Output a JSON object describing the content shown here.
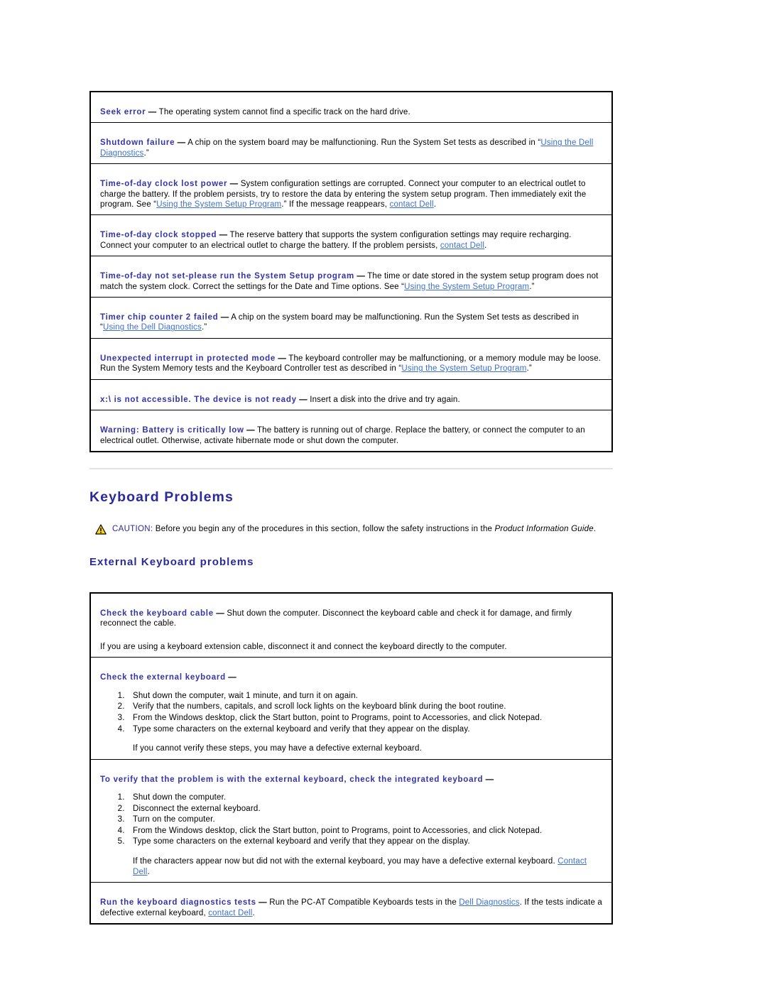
{
  "document": {
    "page_title": "Keyboard Problems"
  },
  "colors": {
    "heading": "#2A2A9C",
    "term": "#3333AA",
    "link": "#3B6FD4",
    "border": "#000000",
    "rule": "#e2e2e2",
    "caution_triangle_fill": "#FFD700",
    "caution_triangle_stroke": "#000000"
  },
  "error_messages_table": {
    "name": "error-messages-table",
    "rows": [
      {
        "term": "Seek error",
        "dash": "—",
        "segments": [
          {
            "type": "text",
            "text": " The operating system cannot find a specific track on the hard drive."
          }
        ]
      },
      {
        "term": "Shutdown failure",
        "dash": "—",
        "segments": [
          {
            "type": "text",
            "text": " A chip on the system board may be malfunctioning. Run the System Set tests as described in “"
          },
          {
            "type": "link",
            "text": "Using the Dell Diagnostics"
          },
          {
            "type": "text",
            "text": ".”"
          }
        ]
      },
      {
        "term": "Time-of-day clock lost power",
        "dash": "—",
        "segments": [
          {
            "type": "text",
            "text": " System configuration settings are corrupted. Connect your computer to an electrical outlet to charge the battery. If the problem persists, try to restore the data by entering the system setup program. Then immediately exit the program. See “"
          },
          {
            "type": "link",
            "text": "Using the System Setup Program"
          },
          {
            "type": "text",
            "text": ".” If the message reappears, "
          },
          {
            "type": "link",
            "text": "contact Dell"
          },
          {
            "type": "text",
            "text": "."
          }
        ]
      },
      {
        "term": "Time-of-day clock stopped",
        "dash": "—",
        "segments": [
          {
            "type": "text",
            "text": " The reserve battery that supports the system configuration settings may require recharging. Connect your computer to an electrical outlet to charge the battery. If the problem persists, "
          },
          {
            "type": "link",
            "text": "contact Dell"
          },
          {
            "type": "text",
            "text": "."
          }
        ]
      },
      {
        "term": "Time-of-day not set-please run the System Setup program",
        "dash": "—",
        "segments": [
          {
            "type": "text",
            "text": " The time or date stored in the system setup program does not match the system clock. Correct the settings for the Date and Time options. See “"
          },
          {
            "type": "link",
            "text": "Using the System Setup Program"
          },
          {
            "type": "text",
            "text": ".”"
          }
        ]
      },
      {
        "term": "Timer chip counter 2 failed",
        "dash": "—",
        "segments": [
          {
            "type": "text",
            "text": " A chip on the system board may be malfunctioning. Run the System Set tests as described in “"
          },
          {
            "type": "link",
            "text": "Using the Dell Diagnostics"
          },
          {
            "type": "text",
            "text": ".”"
          }
        ]
      },
      {
        "term": "Unexpected interrupt in protected mode",
        "dash": "—",
        "segments": [
          {
            "type": "text",
            "text": " The keyboard controller may be malfunctioning, or a memory module may be loose. Run the System Memory tests and the Keyboard Controller test as described in “"
          },
          {
            "type": "link",
            "text": "Using the System Setup Program"
          },
          {
            "type": "text",
            "text": ".”"
          }
        ]
      },
      {
        "term": "x:\\ is not accessible. The device is not ready",
        "dash": "—",
        "segments": [
          {
            "type": "text",
            "text": " Insert a disk into the drive and try again."
          }
        ]
      },
      {
        "term": "Warning: Battery is critically low",
        "dash": "—",
        "segments": [
          {
            "type": "text",
            "text": " The battery is running out of charge. Replace the battery, or connect the computer to an electrical outlet. Otherwise, activate hibernate mode or shut down the computer."
          }
        ]
      }
    ]
  },
  "section": {
    "heading": "Keyboard Problems",
    "caution": {
      "icon": "caution-triangle-icon",
      "label": "CAUTION:",
      "text_before": " Before you begin any of the procedures in this section, follow the safety instructions in the ",
      "italic_text": "Product Information Guide",
      "text_after": "."
    },
    "subheading": "External Keyboard problems"
  },
  "keyboard_table": {
    "name": "external-keyboard-problems-table",
    "rows": [
      {
        "id": "check-keyboard-cable",
        "term": "Check the keyboard cable",
        "dash": "—",
        "segments": [
          {
            "type": "text",
            "text": " Shut down the computer. Disconnect the keyboard cable and check it for damage, and firmly reconnect the cable."
          }
        ],
        "extra_paragraph": "If you are using a keyboard extension cable, disconnect it and connect the keyboard directly to the computer."
      },
      {
        "id": "check-external-keyboard",
        "term": "Check the external keyboard",
        "dash": "—",
        "segments": [],
        "steps": [
          "Shut down the computer, wait 1 minute, and turn it on again.",
          "Verify that the numbers, capitals, and scroll lock lights on the keyboard blink during the boot routine.",
          "From the Windows desktop, click the Start button, point to Programs, point to Accessories, and click Notepad.",
          "Type some characters on the external keyboard and verify that they appear on the display."
        ],
        "after_list": "If you cannot verify these steps, you may have a defective external keyboard."
      },
      {
        "id": "verify-integrated-keyboard",
        "term": "To verify that the problem is with the external keyboard, check the integrated keyboard",
        "dash": "—",
        "segments": [],
        "steps": [
          "Shut down the computer.",
          "Disconnect the external keyboard.",
          "Turn on the computer.",
          "From the Windows desktop, click the Start button, point to Programs, point to Accessories, and click Notepad.",
          "Type some characters on the external keyboard and verify that they appear on the display."
        ],
        "after_list_segments": [
          {
            "type": "text",
            "text": "If the characters appear now but did not with the external keyboard, you may have a defective external keyboard. "
          },
          {
            "type": "link",
            "text": "Contact Dell"
          },
          {
            "type": "text",
            "text": "."
          }
        ]
      },
      {
        "id": "run-keyboard-diagnostics",
        "term": "Run the keyboard diagnostics tests",
        "dash": "—",
        "segments": [
          {
            "type": "text",
            "text": " Run the PC-AT Compatible Keyboards tests in the "
          },
          {
            "type": "link",
            "text": "Dell Diagnostics"
          },
          {
            "type": "text",
            "text": ". If the tests indicate a defective external keyboard, "
          },
          {
            "type": "link",
            "text": "contact Dell"
          },
          {
            "type": "text",
            "text": "."
          }
        ]
      }
    ]
  }
}
